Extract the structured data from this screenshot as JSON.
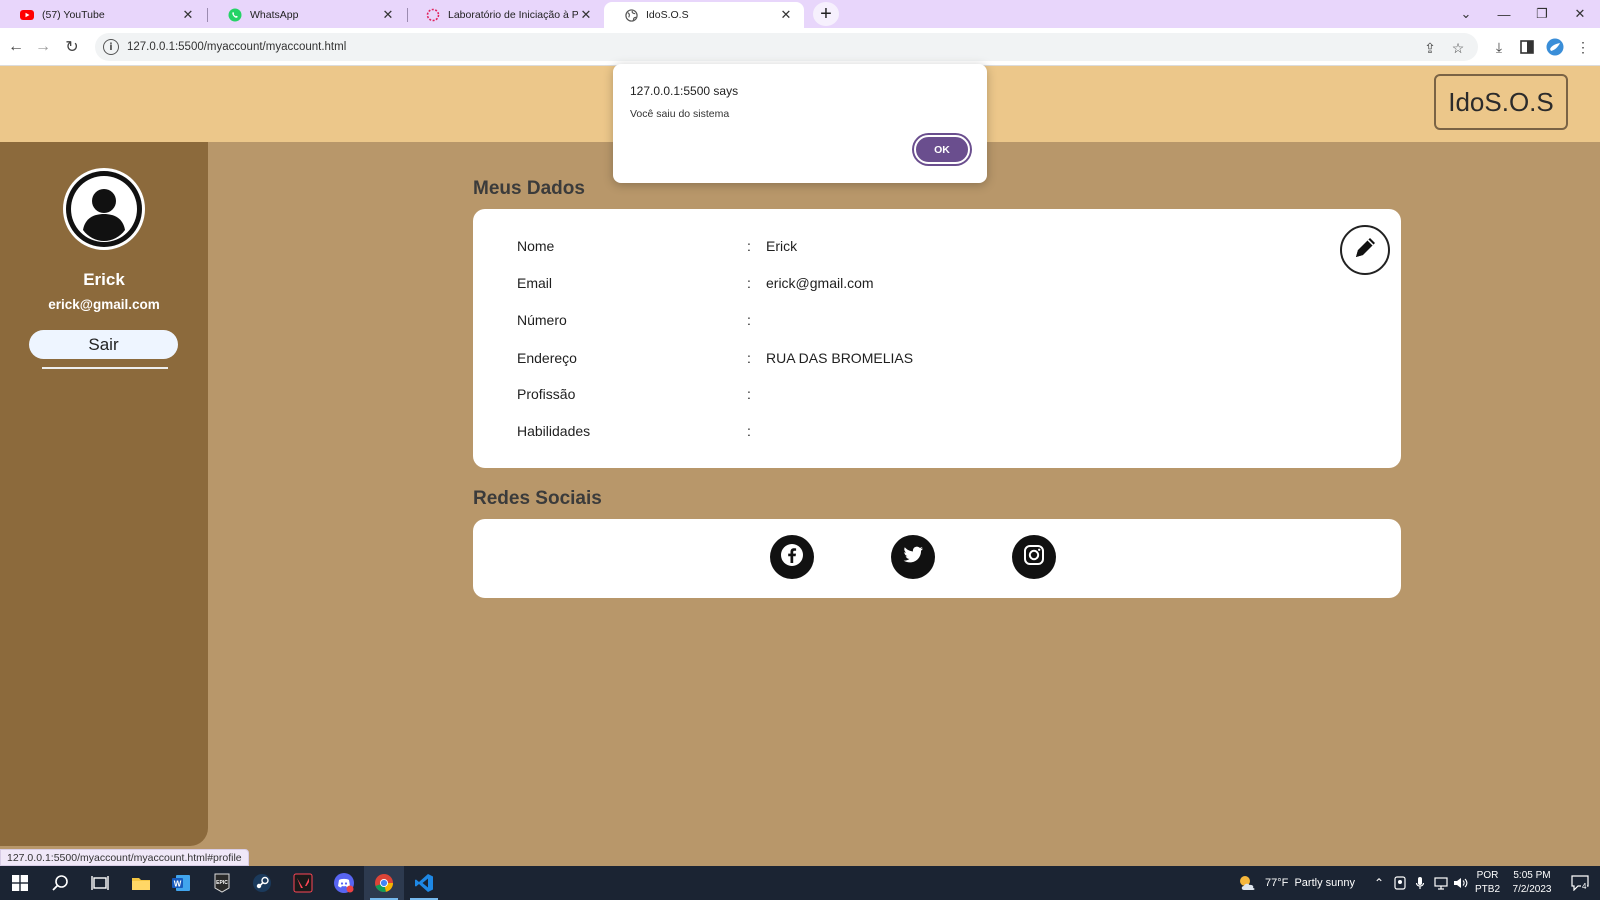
{
  "browser": {
    "tabs": [
      {
        "label": "(57) YouTube",
        "icon": "youtube-icon"
      },
      {
        "label": "WhatsApp",
        "icon": "whatsapp-icon"
      },
      {
        "label": "Laboratório de Iniciação à Prog",
        "icon": "loading-icon"
      },
      {
        "label": "IdoS.O.S",
        "icon": "globe-icon",
        "active": true
      }
    ],
    "url": "127.0.0.1:5500/myaccount/myaccount.html",
    "status_url": "127.0.0.1:5500/myaccount/myaccount.html#profile"
  },
  "header": {
    "brand": "IdoS.O.S"
  },
  "sidebar": {
    "name": "Erick",
    "email": "erick@gmail.com",
    "logout_label": "Sair"
  },
  "profile": {
    "title": "Meus Dados",
    "separator": ":",
    "fields": [
      {
        "label": "Nome",
        "value": "Erick"
      },
      {
        "label": "Email",
        "value": "erick@gmail.com"
      },
      {
        "label": "Número",
        "value": ""
      },
      {
        "label": "Endereço",
        "value": "RUA DAS BROMELIAS"
      },
      {
        "label": "Profissão",
        "value": ""
      },
      {
        "label": "Habilidades",
        "value": ""
      }
    ]
  },
  "social": {
    "title": "Redes Sociais",
    "links": [
      {
        "icon": "facebook-icon"
      },
      {
        "icon": "twitter-icon"
      },
      {
        "icon": "instagram-icon"
      }
    ]
  },
  "dialog": {
    "title": "127.0.0.1:5500 says",
    "message": "Você saiu do sistema",
    "ok_label": "OK"
  },
  "taskbar": {
    "weather": "77°F  Partly sunny",
    "lang_top": "POR",
    "lang_bottom": "PTB2",
    "time": "5:05 PM",
    "date": "7/2/2023",
    "notifications": "4"
  },
  "colors": {
    "header": "#ecc78a",
    "page_bg": "#b8976a",
    "sidebar": "#8c6a3c",
    "dialog_button": "#6a4e8e",
    "tabbar": "#e8d6fb"
  }
}
